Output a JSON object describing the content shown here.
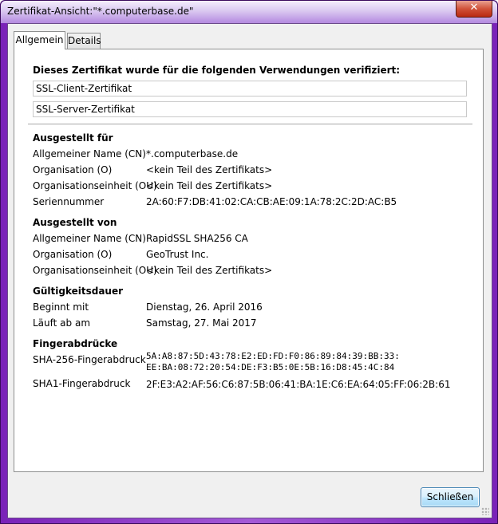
{
  "window": {
    "title": "Zertifikat-Ansicht:\"*.computerbase.de\"",
    "close_glyph": "✕"
  },
  "tabs": [
    {
      "label": "Allgemein",
      "active": true
    },
    {
      "label": "Details",
      "active": false
    }
  ],
  "verification": {
    "heading": "Dieses Zertifikat wurde für die folgenden Verwendungen verifiziert:",
    "usages": [
      "SSL-Client-Zertifikat",
      "SSL-Server-Zertifikat"
    ]
  },
  "issued_to": {
    "title": "Ausgestellt für",
    "rows": [
      {
        "label": "Allgemeiner Name (CN)",
        "value": "*.computerbase.de"
      },
      {
        "label": "Organisation (O)",
        "value": "<kein Teil des Zertifikats>"
      },
      {
        "label": "Organisationseinheit (OU)",
        "value": "<kein Teil des Zertifikats>"
      },
      {
        "label": "Seriennummer",
        "value": "2A:60:F7:DB:41:02:CA:CB:AE:09:1A:78:2C:2D:AC:B5"
      }
    ]
  },
  "issued_by": {
    "title": "Ausgestellt von",
    "rows": [
      {
        "label": "Allgemeiner Name (CN)",
        "value": "RapidSSL SHA256 CA"
      },
      {
        "label": "Organisation (O)",
        "value": "GeoTrust Inc."
      },
      {
        "label": "Organisationseinheit (OU)",
        "value": "<kein Teil des Zertifikats>"
      }
    ]
  },
  "validity": {
    "title": "Gültigkeitsdauer",
    "rows": [
      {
        "label": "Beginnt mit",
        "value": "Dienstag, 26. April 2016"
      },
      {
        "label": "Läuft ab am",
        "value": "Samstag, 27. Mai 2017"
      }
    ]
  },
  "fingerprints": {
    "title": "Fingerabdrücke",
    "sha256_label": "SHA-256-Fingerabdruck",
    "sha256_line1": "5A:A8:87:5D:43:78:E2:ED:FD:F0:86:89:84:39:BB:33:",
    "sha256_line2": "EE:BA:08:72:20:54:DE:F3:B5:0E:5B:16:D8:45:4C:84",
    "sha1_label": "SHA1-Fingerabdruck",
    "sha1_value": "2F:E3:A2:AF:56:C6:87:5B:06:41:BA:1E:C6:EA:64:05:FF:06:2B:61"
  },
  "footer": {
    "close_label": "Schließen"
  }
}
